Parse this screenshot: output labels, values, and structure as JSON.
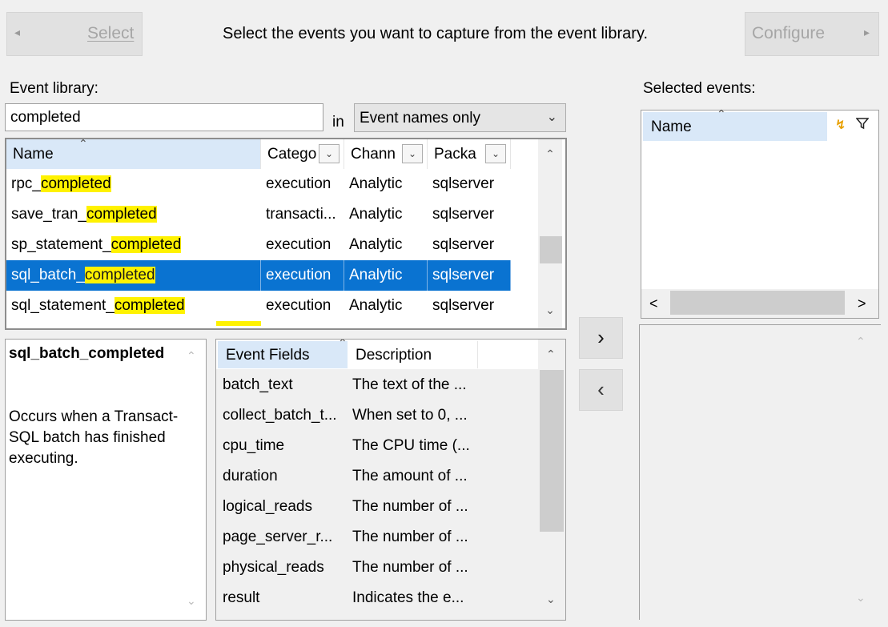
{
  "header": {
    "select_label": "Select",
    "select_arrow": "◂",
    "instruction": "Select the events you want to capture from the event library.",
    "configure_label": "Configure",
    "configure_arrow": "▸"
  },
  "library": {
    "label": "Event library:",
    "search_value": "completed",
    "in_label": "in",
    "scope_selected": "Event names only",
    "columns": [
      "Name",
      "Catego",
      "Chann",
      "Packa"
    ],
    "rows": [
      {
        "pre": "rpc_",
        "hl": "completed",
        "post": "",
        "category": "execution",
        "channel": "Analytic",
        "package": "sqlserver",
        "selected": false
      },
      {
        "pre": "save_tran_",
        "hl": "completed",
        "post": "",
        "category": "transacti...",
        "channel": "Analytic",
        "package": "sqlserver",
        "selected": false
      },
      {
        "pre": "sp_statement_",
        "hl": "completed",
        "post": "",
        "category": "execution",
        "channel": "Analytic",
        "package": "sqlserver",
        "selected": false
      },
      {
        "pre": "sql_batch_",
        "hl": "completed",
        "post": "",
        "category": "execution",
        "channel": "Analytic",
        "package": "sqlserver",
        "selected": true
      },
      {
        "pre": "sql_statement_",
        "hl": "completed",
        "post": "",
        "category": "execution",
        "channel": "Analytic",
        "package": "sqlserver",
        "selected": false
      }
    ],
    "scroll_fraction": 0.65
  },
  "move": {
    "add_label": "›",
    "remove_label": "‹"
  },
  "selected": {
    "label": "Selected events:",
    "column_name": "Name",
    "left_arrow": "<",
    "right_arrow": ">"
  },
  "description": {
    "title": "sql_batch_completed",
    "text": "Occurs when a Transact-SQL batch has finished executing."
  },
  "fields": {
    "columns": [
      "Event Fields",
      "Description"
    ],
    "rows": [
      {
        "name": "batch_text",
        "desc": "The text of the ..."
      },
      {
        "name": "collect_batch_t...",
        "desc": "When set to 0, ..."
      },
      {
        "name": "cpu_time",
        "desc": "The CPU time (..."
      },
      {
        "name": "duration",
        "desc": "The amount of ..."
      },
      {
        "name": "logical_reads",
        "desc": "The number of ..."
      },
      {
        "name": "page_server_r...",
        "desc": "The number of ..."
      },
      {
        "name": "physical_reads",
        "desc": "The number of ..."
      },
      {
        "name": "result",
        "desc": "Indicates the e..."
      }
    ]
  },
  "colors": {
    "selection": "#0a73d1",
    "highlight": "#fff200",
    "disabled_text": "#a6a6a6"
  }
}
